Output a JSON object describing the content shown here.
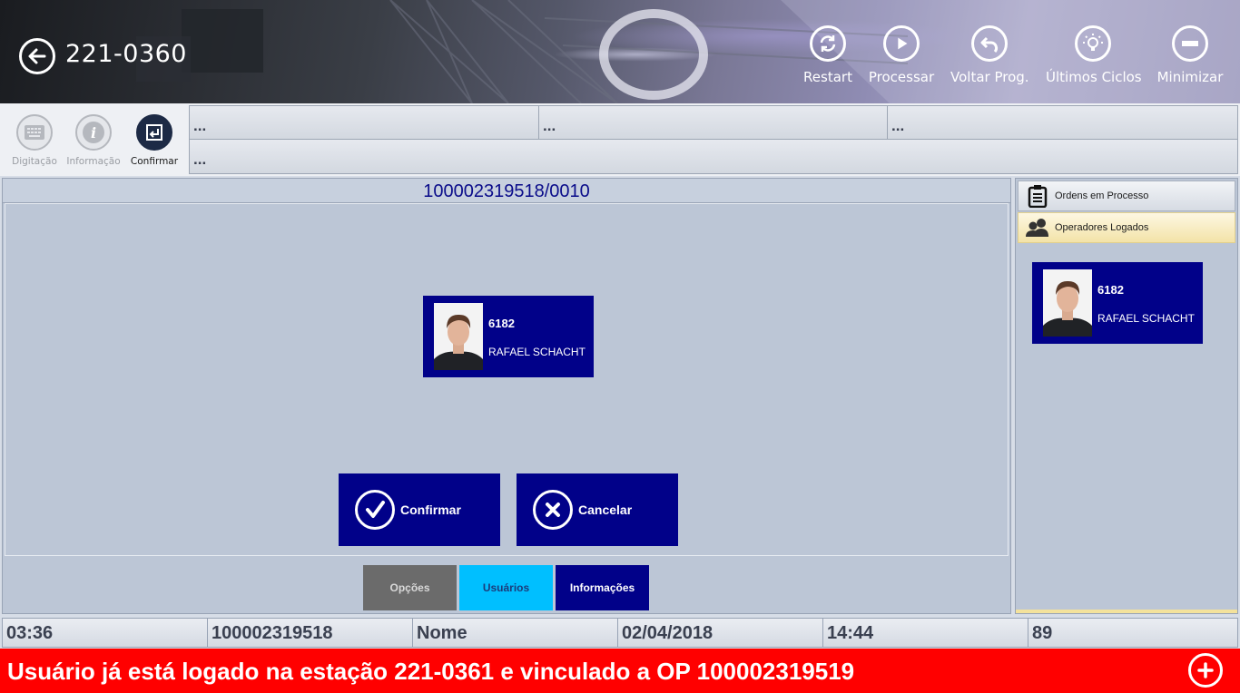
{
  "header": {
    "station": "221-0360",
    "tools": [
      {
        "label": "Restart",
        "icon": "refresh-icon"
      },
      {
        "label": "Processar",
        "icon": "play-icon"
      },
      {
        "label": "Voltar Prog.",
        "icon": "undo-icon"
      },
      {
        "label": "Últimos Ciclos",
        "icon": "lightbulb-icon"
      },
      {
        "label": "Minimizar",
        "icon": "minus-icon"
      }
    ]
  },
  "toolbar": {
    "buttons": [
      {
        "label": "Digitação",
        "icon": "keyboard-icon",
        "enabled": false
      },
      {
        "label": "Informação",
        "icon": "info-icon",
        "enabled": false
      },
      {
        "label": "Confirmar",
        "icon": "enter-icon",
        "enabled": true
      }
    ],
    "info_cells": [
      "...",
      "...",
      "...",
      "..."
    ]
  },
  "main": {
    "order_title": "100002319518/0010",
    "operator_card": {
      "code": "6182",
      "name": "RAFAEL SCHACHT"
    },
    "confirm_label": "Confirmar",
    "cancel_label": "Cancelar",
    "tabs": [
      {
        "label": "Opções",
        "color": "#6b6b6b",
        "text_color": "#d8d8d8"
      },
      {
        "label": "Usuários",
        "color": "#00bfff",
        "text_color": "#1b3b7a"
      },
      {
        "label": "Informações",
        "color": "#010189",
        "text_color": "#ffffff"
      }
    ]
  },
  "side": {
    "tabs": [
      {
        "label": "Ordens em Processo",
        "icon": "clipboard-icon"
      },
      {
        "label": "Operadores Logados",
        "icon": "users-icon"
      }
    ],
    "operator": {
      "code": "6182",
      "name": "RAFAEL SCHACHT"
    }
  },
  "status": {
    "cells": [
      "03:36",
      "100002319518",
      "Nome",
      "02/04/2018",
      "14:44",
      "89"
    ]
  },
  "alert": {
    "message": "Usuário já está logado na estação 221-0361 e vinculado a OP 100002319519",
    "color": "#ff0000"
  },
  "colors": {
    "accent": "#010189",
    "tab_active": "#00bfff"
  }
}
